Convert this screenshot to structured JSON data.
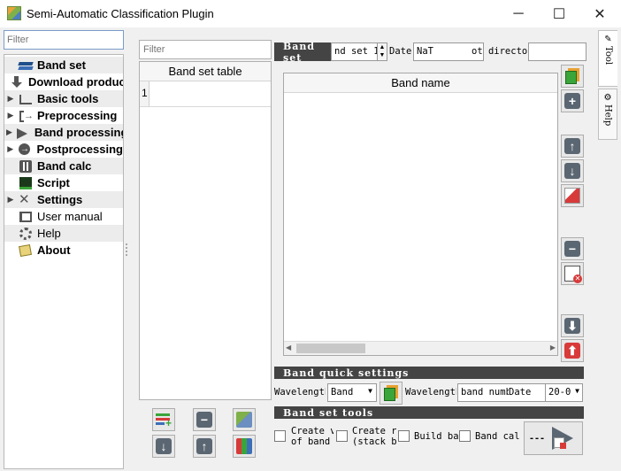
{
  "window": {
    "title": "Semi-Automatic Classification Plugin",
    "controls": [
      "─",
      "☐",
      "✕"
    ]
  },
  "left": {
    "filter_placeholder": "Filter",
    "tree": [
      {
        "label": "Band set",
        "icon": "band-set-icon",
        "expandable": false,
        "bold": true
      },
      {
        "label": "Download products",
        "icon": "download-icon",
        "expandable": false,
        "bold": true
      },
      {
        "label": "Basic tools",
        "icon": "basic-tools-icon",
        "expandable": true,
        "bold": true
      },
      {
        "label": "Preprocessing",
        "icon": "preprocessing-icon",
        "expandable": true,
        "bold": true
      },
      {
        "label": "Band processing",
        "icon": "band-processing-icon",
        "expandable": true,
        "bold": true
      },
      {
        "label": "Postprocessing",
        "icon": "postprocessing-icon",
        "expandable": true,
        "bold": true
      },
      {
        "label": "Band calc",
        "icon": "band-calc-icon",
        "expandable": false,
        "bold": true
      },
      {
        "label": "Script",
        "icon": "script-icon",
        "expandable": false,
        "bold": true
      },
      {
        "label": "Settings",
        "icon": "settings-icon",
        "expandable": true,
        "bold": true
      },
      {
        "label": "User manual",
        "icon": "user-manual-icon",
        "expandable": false,
        "bold": false
      },
      {
        "label": "Help",
        "icon": "help-icon",
        "expandable": false,
        "bold": false
      },
      {
        "label": "About",
        "icon": "about-icon",
        "expandable": false,
        "bold": true
      }
    ]
  },
  "band_set_table": {
    "filter_placeholder": "Filter",
    "header": "Band set table",
    "rows": [
      "1"
    ]
  },
  "band_set": {
    "header": "Band set",
    "band_set_value": "nd set 1",
    "date_label": "Date",
    "date_value": "NaT",
    "directory_label": "ot director",
    "directory_value": "",
    "band_name_header": "Band name"
  },
  "quick_settings": {
    "header": "Band quick settings",
    "wavelength_label_1": "Wavelength",
    "wavelength_select": "Band",
    "wavelength_label_2": "Wavelength",
    "band_number_select": "band numbe",
    "date_label": "Date",
    "date_value": "20-0"
  },
  "band_set_tools": {
    "header": "Band set tools",
    "options": [
      {
        "label_line1": "Create v",
        "label_line2": "of band"
      },
      {
        "label_line1": "Create r",
        "label_line2": "(stack b"
      },
      {
        "label_line1": "Build ba",
        "label_line2": ""
      },
      {
        "label_line1": "Band cal",
        "label_line2": ""
      }
    ],
    "run_label": "---"
  },
  "side_tabs": [
    {
      "label": "Tool",
      "icon": "tool-icon"
    },
    {
      "label": "Help",
      "icon": "help-icon"
    }
  ],
  "colors": {
    "section_header_bg": "#444444",
    "accent_green": "#3aa53a",
    "accent_red": "#d83a3a",
    "accent_blue": "#3d6fb8"
  }
}
